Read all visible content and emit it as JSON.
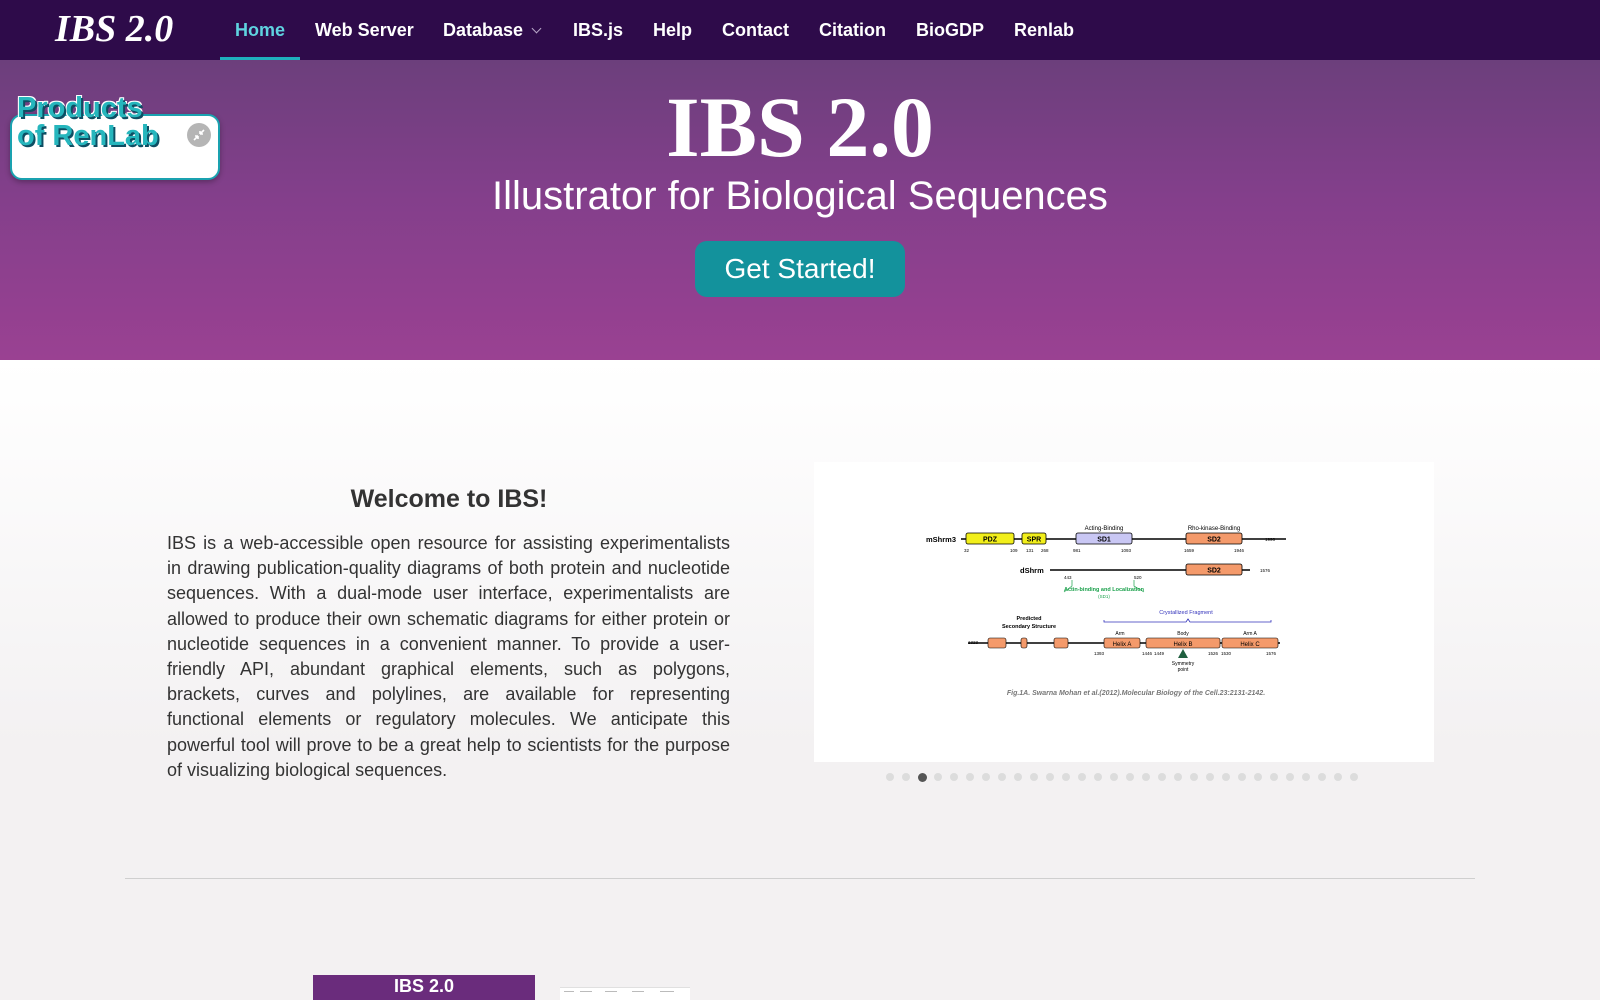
{
  "navbar": {
    "brand": "IBS 2.0",
    "items": [
      {
        "label": "Home",
        "active": true
      },
      {
        "label": "Web Server"
      },
      {
        "label": "Database",
        "has_dropdown": true
      },
      {
        "label": "IBS.js"
      },
      {
        "label": "Help"
      },
      {
        "label": "Contact"
      },
      {
        "label": "Citation"
      },
      {
        "label": "BioGDP"
      },
      {
        "label": "Renlab"
      }
    ]
  },
  "hero": {
    "title": "IBS 2.0",
    "subtitle": "Illustrator for Biological Sequences",
    "cta_label": "Get Started!"
  },
  "widget": {
    "title_line1": "Products",
    "title_line2": "of RenLab",
    "collapse_icon": "collapse-arrows-icon"
  },
  "welcome": {
    "title": "Welcome to IBS!",
    "text": "IBS is a web-accessible open resource for assisting experimentalists in drawing publication-quality diagrams of both protein and nucleotide sequences. With a dual-mode user interface, experimentalists are allowed to produce their own schematic diagrams for either protein or nucleotide sequences in a convenient manner. To provide a user-friendly API, abundant graphical elements, such as polygons, brackets, curves and polylines, are available for representing functional elements or regulatory molecules. We anticipate this powerful tool will prove to be a great help to scientists for the purpose of visualizing biological sequences."
  },
  "carousel": {
    "slide_count": 30,
    "active_index": 2,
    "figure": {
      "row1": {
        "name": "mShrm3",
        "labels_above": [
          "Acting-Binding",
          "Rho-kinase-Binding"
        ],
        "domains": [
          "PDZ",
          "SPR",
          "SD1",
          "SD2"
        ],
        "positions": [
          "32",
          "109",
          "131",
          "268",
          "981",
          "1093",
          "1659",
          "1946",
          "1996"
        ]
      },
      "row2": {
        "name": "dShrm",
        "domains": [
          "SD2"
        ],
        "positions": [
          "443",
          "520",
          "1576"
        ],
        "annotation": "Actin-binding and Localization",
        "annotation_sub": "(SD1)"
      },
      "row3": {
        "label_line1": "Predicted",
        "label_line2": "Secondary Structure",
        "bracket_label": "Crystallized Fragment",
        "region_labels": [
          "Arm",
          "Body",
          "Arm A"
        ],
        "domains": [
          "Helix A",
          "Helix B",
          "Helix C"
        ],
        "positions": [
          "1323",
          "1393",
          "1446",
          "1449",
          "1526",
          "1530",
          "1576"
        ],
        "symmetry_line1": "Symmetry",
        "symmetry_line2": "point"
      },
      "caption": "Fig.1A. Swarna Mohan et al.(2012).Molecular Biology of the Cell.23:2131-2142."
    }
  },
  "thumbnails": {
    "first_title": "IBS 2.0"
  },
  "colors": {
    "navbar_bg": "#2e0b4a",
    "hero_top": "#6c3f7c",
    "hero_bottom": "#9a4192",
    "accent_teal": "#13929c",
    "active_nav": "#5fd3e0"
  }
}
